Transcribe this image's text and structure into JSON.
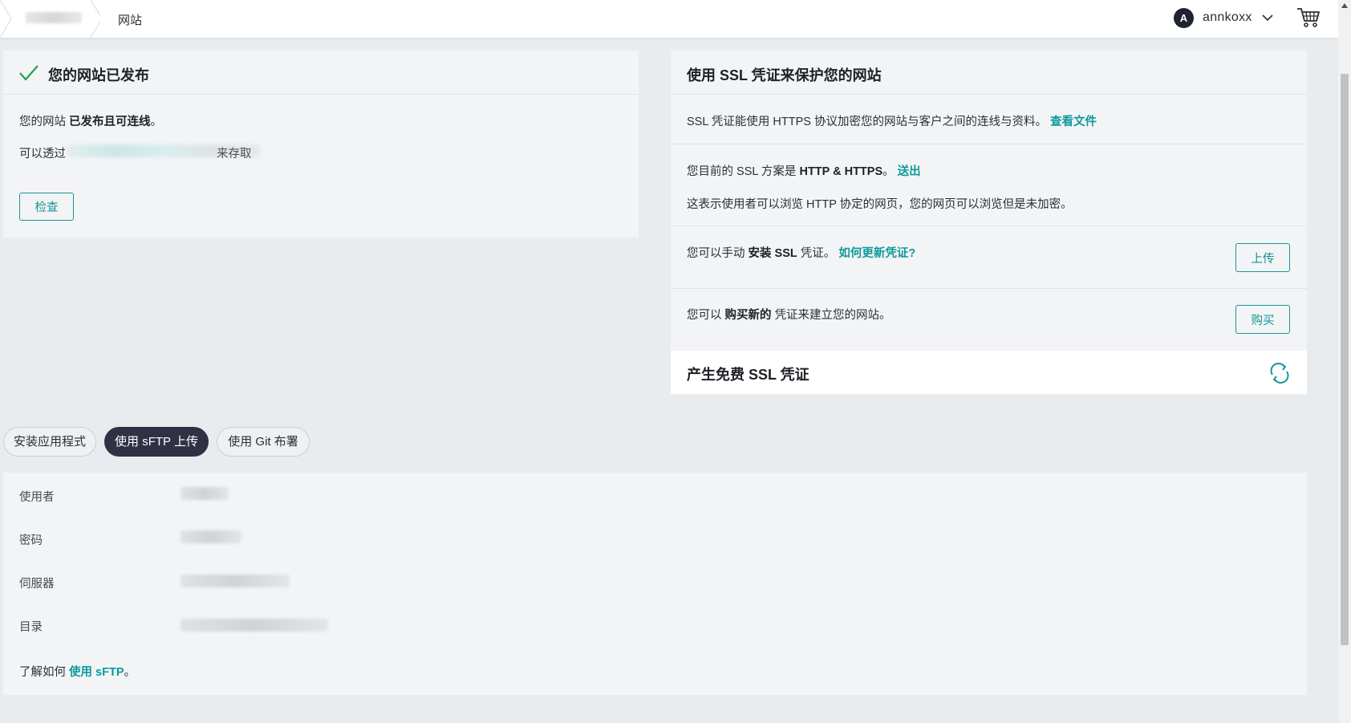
{
  "header": {
    "breadcrumb_current": "网站",
    "user": {
      "avatar_initial": "A",
      "username": "annkoxx"
    },
    "icons": [
      "chevron-down-icon",
      "cart-icon"
    ]
  },
  "published_card": {
    "title": "您的网站已发布",
    "status_prefix": "您的网站",
    "status_bold": "已发布且可连线",
    "status_suffix": "。",
    "access_prefix": "可以透过",
    "access_suffix": "来存取",
    "check_button": "检查"
  },
  "ssl_card": {
    "title": "使用 SSL 凭证来保护您的网站",
    "intro_text": "SSL 凭证能使用 HTTPS 协议加密您的网站与客户之间的连线与资料。",
    "intro_link": "查看文件",
    "plan_prefix": "您目前的 SSL 方案是",
    "plan_bold": "HTTP & HTTPS",
    "plan_suffix": "。",
    "plan_link": "送出",
    "plan_note": "这表示使用者可以浏览 HTTP 协定的网页，您的网页可以浏览但是未加密。",
    "manual_prefix": "您可以手动",
    "manual_bold": "安装 SSL",
    "manual_suffix": "凭证。",
    "manual_link": "如何更新凭证?",
    "upload_button": "上传",
    "buy_prefix": "您可以",
    "buy_bold": "购买新的",
    "buy_suffix": "凭证来建立您的网站。",
    "buy_button": "购买",
    "free_ssl_title": "产生免费 SSL 凭证"
  },
  "tabs": [
    {
      "label": "安装应用程式",
      "active": false
    },
    {
      "label": "使用 sFTP 上传",
      "active": true
    },
    {
      "label": "使用 Git 布署",
      "active": false
    }
  ],
  "sftp": {
    "fields": [
      {
        "label": "使用者"
      },
      {
        "label": "密码"
      },
      {
        "label": "伺服器"
      },
      {
        "label": "目录"
      }
    ],
    "learn_prefix": "了解如何",
    "learn_link": "使用 sFTP",
    "learn_suffix": "。"
  },
  "colors": {
    "accent": "#139999",
    "tab_active_bg": "#2f3245",
    "success_check": "#1aa34a",
    "page_bg": "#e8ecef"
  }
}
